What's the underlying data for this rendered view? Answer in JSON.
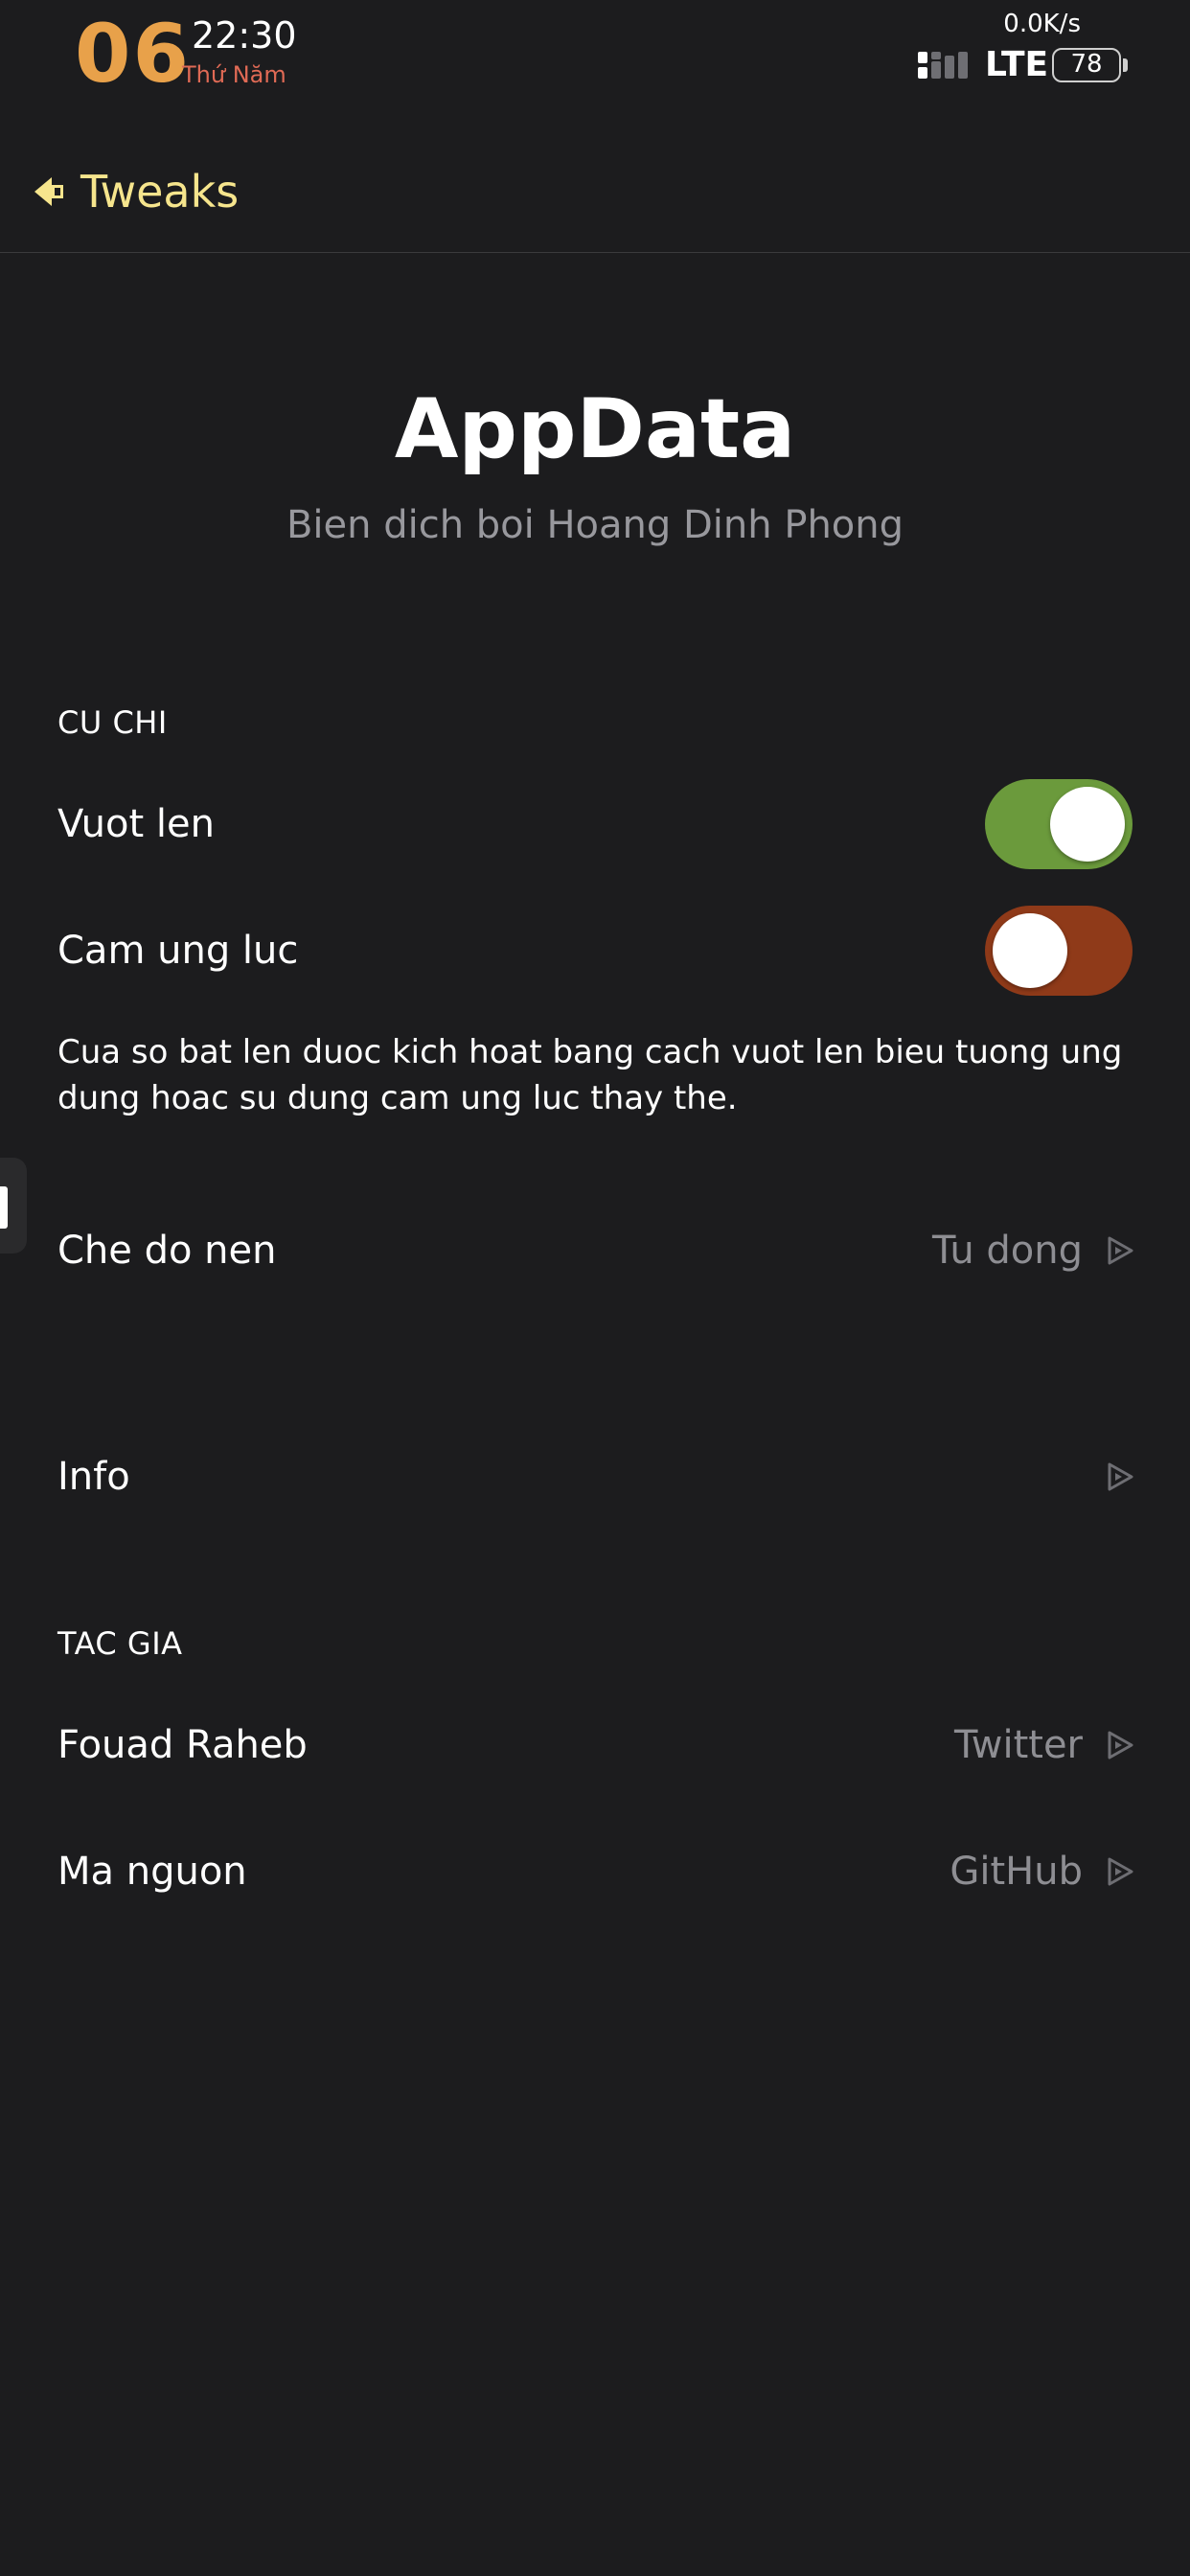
{
  "status_bar": {
    "day": "06",
    "time": "22:30",
    "weekday": "Thứ Năm",
    "net_speed": "0.0K/s",
    "network": "LTE",
    "battery": "78"
  },
  "nav": {
    "back_label": "Tweaks"
  },
  "header": {
    "title": "AppData",
    "subtitle": "Bien dich boi Hoang Dinh Phong"
  },
  "sections": {
    "gestures": {
      "header": "CU CHI",
      "swipe_up": {
        "label": "Vuot len",
        "on": true
      },
      "force_touch": {
        "label": "Cam ung luc",
        "on": false
      },
      "footer": "Cua so bat len duoc kich hoat bang cach vuot len bieu tuong ung dung hoac su dung cam ung luc thay the."
    },
    "background": {
      "label": "Che do nen",
      "value": "Tu dong"
    },
    "info": {
      "label": "Info"
    },
    "author": {
      "header": "TAC GIA",
      "name_row": {
        "label": "Fouad Raheb",
        "value": "Twitter"
      },
      "source_row": {
        "label": "Ma nguon",
        "value": "GitHub"
      }
    }
  },
  "colors": {
    "accent": "#f6e58d",
    "toggle_on": "#6b9a3c",
    "toggle_off": "#8f3a19",
    "clock_day": "#e8a14a",
    "weekday": "#e06a55"
  }
}
